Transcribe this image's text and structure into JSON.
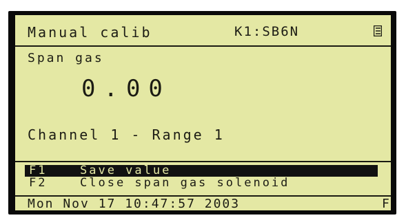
{
  "header": {
    "title": "Manual calib",
    "component": "K1:SB6N",
    "menu_icon": "list-icon"
  },
  "main": {
    "label": "Span gas",
    "value": "0.00",
    "channel_info": "Channel 1 - Range 1"
  },
  "function_keys": [
    {
      "key": "F1",
      "label": "Save value",
      "highlighted": true
    },
    {
      "key": "F2",
      "label": "Close span gas solenoid",
      "highlighted": false
    }
  ],
  "status_bar": {
    "datetime": "Mon Nov 17 10:47:57 2003",
    "indicator": "F"
  },
  "colors": {
    "lcd_background": "#e4e8a4",
    "lcd_text": "#1c1c14",
    "bezel": "#0a0a0a"
  }
}
